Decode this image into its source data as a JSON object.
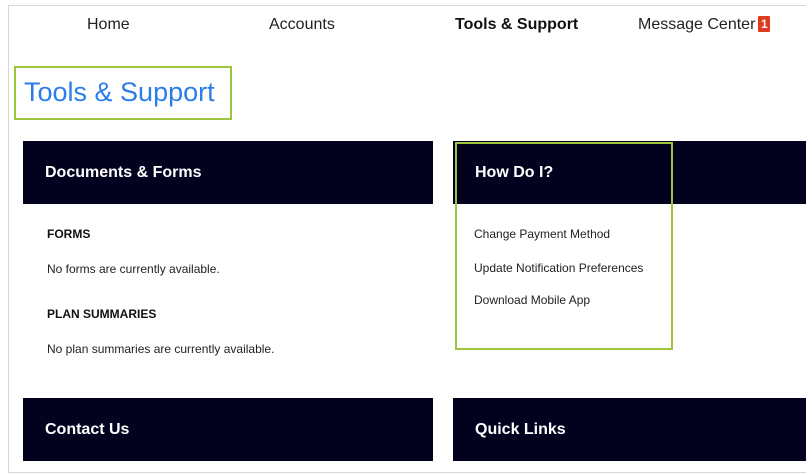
{
  "nav": {
    "items": [
      {
        "label": "Home",
        "active": false
      },
      {
        "label": "Accounts",
        "active": false
      },
      {
        "label": "Tools & Support",
        "active": true
      },
      {
        "label": "Message Center",
        "active": false
      }
    ],
    "message_badge": "1"
  },
  "page": {
    "title": "Tools & Support"
  },
  "documents_forms": {
    "header": "Documents & Forms",
    "forms_label": "FORMS",
    "forms_empty": "No forms are currently available.",
    "plan_label": "PLAN SUMMARIES",
    "plan_empty": "No plan summaries are currently available."
  },
  "how_do_i": {
    "header": "How Do I?",
    "links": [
      "Change Payment Method",
      "Update Notification Preferences",
      "Download Mobile App"
    ]
  },
  "contact_us": {
    "header": "Contact Us"
  },
  "quick_links": {
    "header": "Quick Links"
  },
  "colors": {
    "header_bg": "#02021e",
    "title_blue": "#2b7de9",
    "highlight_green": "#9cc43c",
    "badge_red": "#e03a1c"
  }
}
